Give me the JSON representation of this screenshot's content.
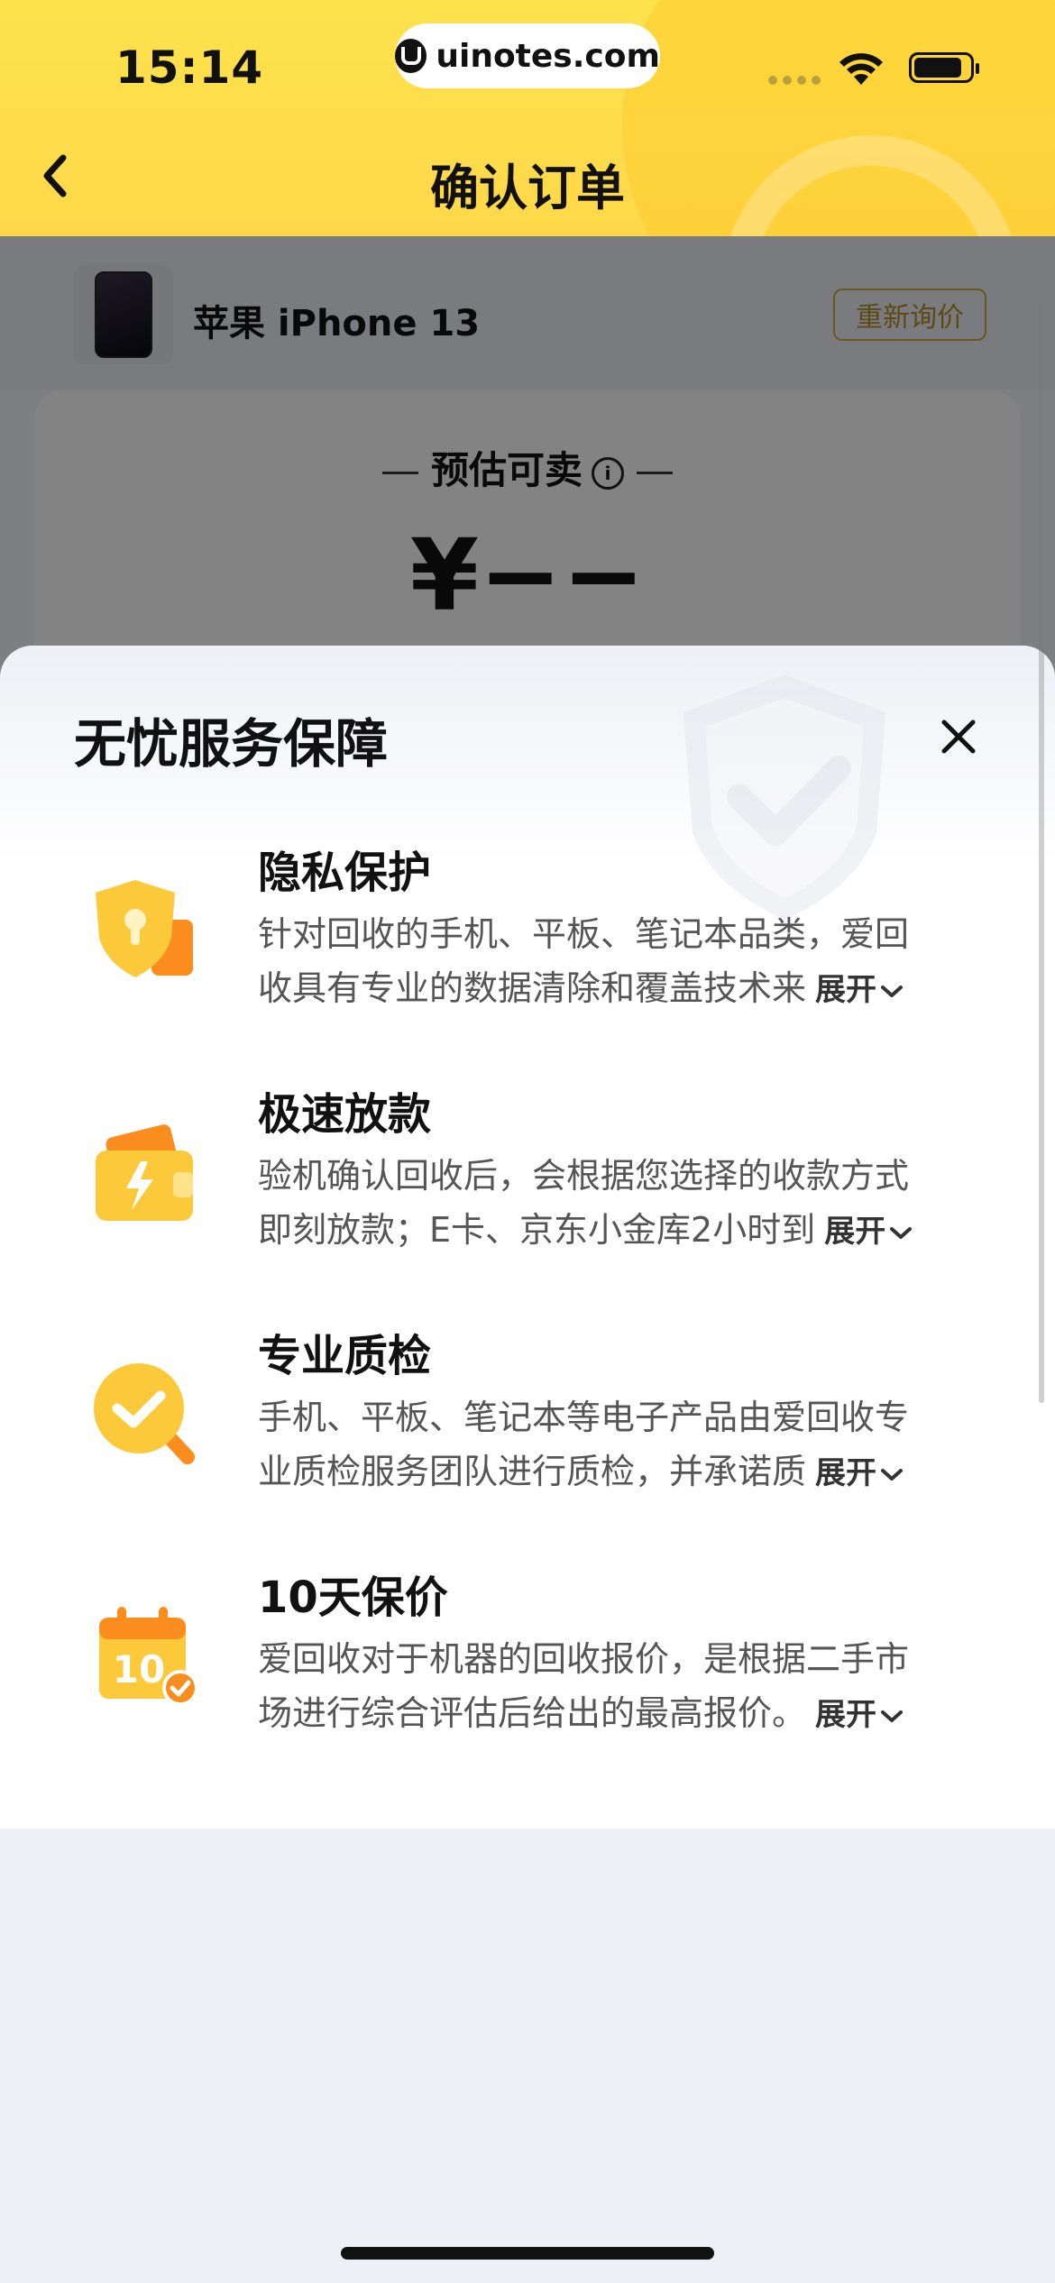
{
  "status_bar": {
    "time": "15:14",
    "url": "uinotes.com",
    "icons": [
      "signal-dots-icon",
      "wifi-icon",
      "battery-icon"
    ]
  },
  "nav": {
    "back_icon": "chevron-left-icon",
    "title": "确认订单"
  },
  "product": {
    "name": "苹果 iPhone 13",
    "requote_label": "重新询价"
  },
  "estimate": {
    "title": "预估可卖",
    "info_icon": "info-icon",
    "price": "¥−−"
  },
  "sheet": {
    "title": "无忧服务保障",
    "close_icon": "close-icon",
    "items": [
      {
        "icon": "privacy-shield-icon",
        "title": "隐私保护",
        "desc_line1": "针对回收的手机、平板、笔记本品类，爱回",
        "desc_line2": "收具有专业的数据清除和覆盖技术来",
        "expand": "展开"
      },
      {
        "icon": "fast-payment-wallet-icon",
        "title": "极速放款",
        "desc_line1": "验机确认回收后，会根据您选择的收款方式",
        "desc_line2": "即刻放款；E卡、京东小金库2小时到",
        "expand": "展开"
      },
      {
        "icon": "quality-check-magnifier-icon",
        "title": "专业质检",
        "desc_line1": "手机、平板、笔记本等电子产品由爱回收专",
        "desc_line2": "业质检服务团队进行质检，并承诺质",
        "expand": "展开"
      },
      {
        "icon": "price-protection-calendar-icon",
        "title": "10天保价",
        "desc_line1": "爱回收对于机器的回收报价，是根据二手市",
        "desc_line2": "场进行综合评估后给出的最高报价。",
        "expand": "展开"
      }
    ]
  },
  "colors": {
    "brand_yellow": "#fde24c",
    "icon_orange": "#fb8c1e",
    "icon_yellow": "#fcc93a"
  }
}
